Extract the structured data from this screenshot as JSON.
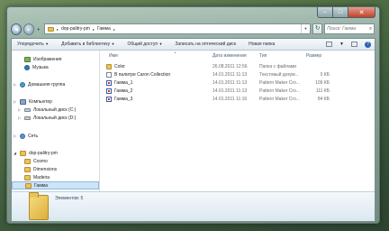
{
  "window": {
    "controls": {
      "minimize": "–",
      "maximize": "□",
      "close": "✕"
    }
  },
  "address": {
    "crumbs": [
      "dop-palitry-pm",
      "Гамма"
    ],
    "search_placeholder": "Поиск: Гамма"
  },
  "toolbar": {
    "organize": "Упорядочить",
    "add_to_library": "Добавить в библиотеку",
    "share": "Общий доступ",
    "burn": "Записать на оптический диск",
    "new_folder": "Новая папка"
  },
  "nav": [
    {
      "label": "Изображения",
      "icon": "img",
      "indent": 1,
      "expand": ""
    },
    {
      "label": "Музыка",
      "icon": "music",
      "indent": 1,
      "expand": ""
    },
    {
      "label": "Домашняя группа",
      "icon": "group",
      "indent": 0,
      "expand": "▷"
    },
    {
      "label": "Компьютер",
      "icon": "pc",
      "indent": 0,
      "expand": "▷"
    },
    {
      "label": "Локальный диск (C:)",
      "icon": "disk",
      "indent": 1,
      "expand": "▷"
    },
    {
      "label": "Локальный диск (D:)",
      "icon": "disk",
      "indent": 1,
      "expand": "▷"
    },
    {
      "label": "Сеть",
      "icon": "net",
      "indent": 0,
      "expand": "▷"
    },
    {
      "label": "dop-palitry-pm",
      "icon": "folder",
      "indent": 0,
      "expand": "◢"
    },
    {
      "label": "Cosmo",
      "icon": "folder",
      "indent": 1,
      "expand": ""
    },
    {
      "label": "Dimensions",
      "icon": "folder",
      "indent": 1,
      "expand": ""
    },
    {
      "label": "Madeira",
      "icon": "folder",
      "indent": 1,
      "expand": ""
    },
    {
      "label": "Гамма",
      "icon": "folder",
      "indent": 1,
      "expand": "",
      "selected": true
    }
  ],
  "columns": {
    "name": "Имя",
    "date": "Дата изменения",
    "type": "Тип",
    "size": "Размер"
  },
  "files": [
    {
      "name": "Color",
      "date": "26.08.2011 12:56",
      "type": "Папка с файлами",
      "size": "",
      "icon": "folder"
    },
    {
      "name": "В палитре Caron Collection",
      "date": "14.01.2011 11:13",
      "type": "Текстовый докум...",
      "size": "0 КБ",
      "icon": "doc"
    },
    {
      "name": "Гамма_1",
      "date": "14.01.2011 11:13",
      "type": "Pattern Maker Cro...",
      "size": "109 КБ",
      "icon": "pat"
    },
    {
      "name": "Гамма_2",
      "date": "14.01.2011 11:13",
      "type": "Pattern Maker Cro...",
      "size": "111 КБ",
      "icon": "pat"
    },
    {
      "name": "Гамма_3",
      "date": "14.01.2011 11:16",
      "type": "Pattern Maker Cro...",
      "size": "84 КБ",
      "icon": "pat"
    }
  ],
  "status": {
    "items_count": "Элементов: 5"
  }
}
